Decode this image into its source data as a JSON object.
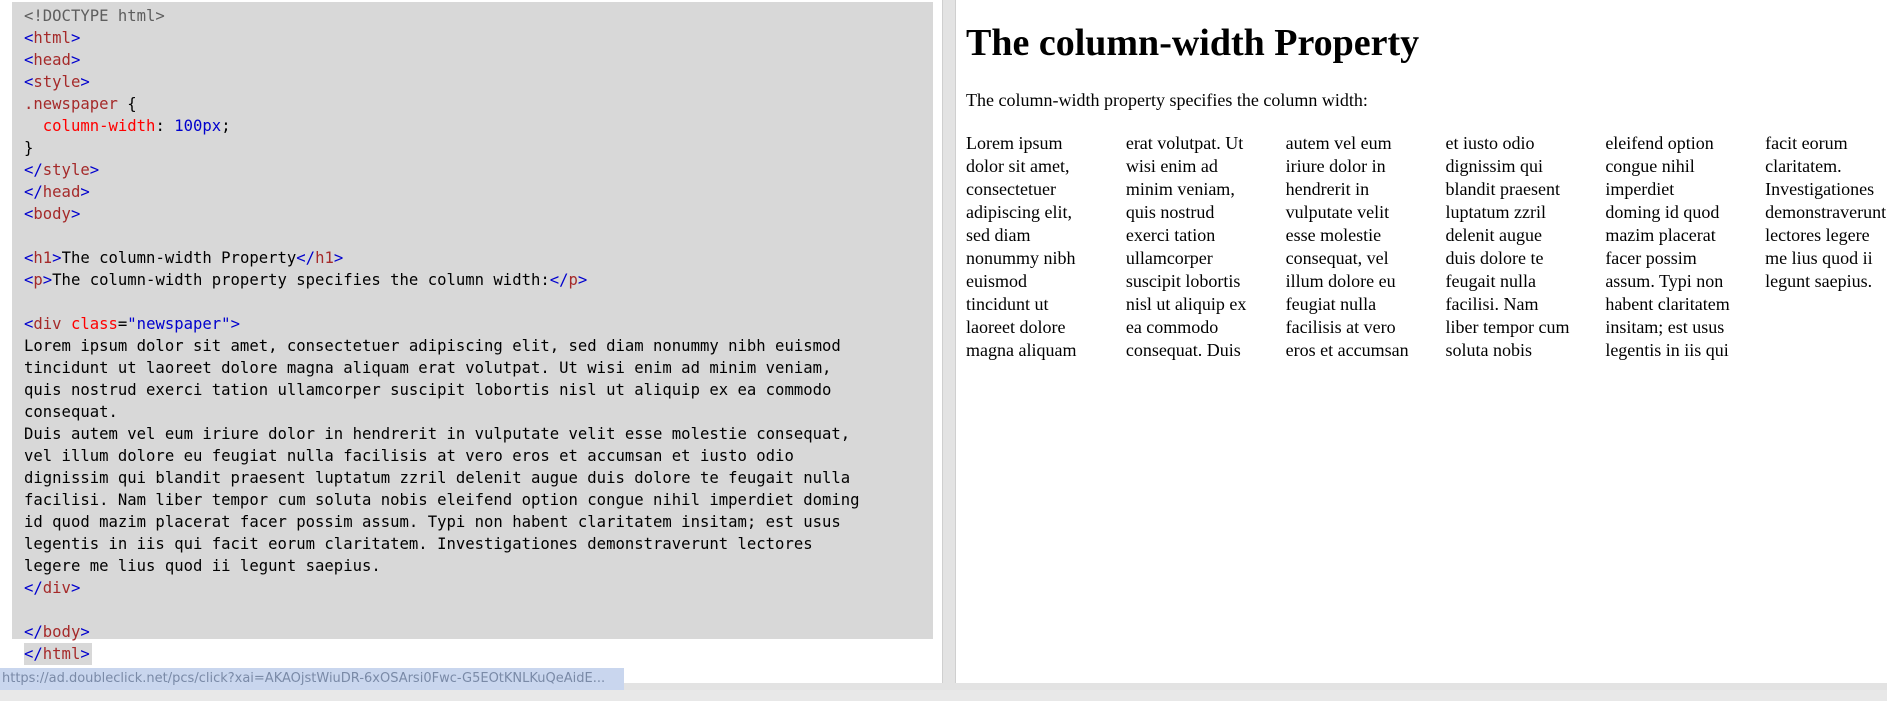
{
  "editor": {
    "lines": [
      [
        {
          "c": "t-doctype",
          "t": "<!DOCTYPE html>"
        }
      ],
      [
        {
          "c": "t-br",
          "t": "<"
        },
        {
          "c": "t-tag",
          "t": "html"
        },
        {
          "c": "t-br",
          "t": ">"
        }
      ],
      [
        {
          "c": "t-br",
          "t": "<"
        },
        {
          "c": "t-tag",
          "t": "head"
        },
        {
          "c": "t-br",
          "t": ">"
        }
      ],
      [
        {
          "c": "t-br",
          "t": "<"
        },
        {
          "c": "t-tag",
          "t": "style"
        },
        {
          "c": "t-br",
          "t": ">"
        }
      ],
      [
        {
          "c": "t-sel",
          "t": ".newspaper"
        },
        {
          "c": "t-text",
          "t": " {"
        }
      ],
      [
        {
          "c": "t-text",
          "t": "  "
        },
        {
          "c": "t-prop",
          "t": "column-width"
        },
        {
          "c": "t-text",
          "t": ": "
        },
        {
          "c": "t-val",
          "t": "100px"
        },
        {
          "c": "t-text",
          "t": ";"
        }
      ],
      [
        {
          "c": "t-text",
          "t": "}"
        }
      ],
      [
        {
          "c": "t-br",
          "t": "</"
        },
        {
          "c": "t-tag",
          "t": "style"
        },
        {
          "c": "t-br",
          "t": ">"
        }
      ],
      [
        {
          "c": "t-br",
          "t": "</"
        },
        {
          "c": "t-tag",
          "t": "head"
        },
        {
          "c": "t-br",
          "t": ">"
        }
      ],
      [
        {
          "c": "t-br",
          "t": "<"
        },
        {
          "c": "t-tag",
          "t": "body"
        },
        {
          "c": "t-br",
          "t": ">"
        }
      ],
      [],
      [
        {
          "c": "t-br",
          "t": "<"
        },
        {
          "c": "t-tag",
          "t": "h1"
        },
        {
          "c": "t-br",
          "t": ">"
        },
        {
          "c": "t-text",
          "t": "The column-width Property"
        },
        {
          "c": "t-br",
          "t": "</"
        },
        {
          "c": "t-tag",
          "t": "h1"
        },
        {
          "c": "t-br",
          "t": ">"
        }
      ],
      [
        {
          "c": "t-br",
          "t": "<"
        },
        {
          "c": "t-tag",
          "t": "p"
        },
        {
          "c": "t-br",
          "t": ">"
        },
        {
          "c": "t-text",
          "t": "The column-width property specifies the column width:"
        },
        {
          "c": "t-br",
          "t": "</"
        },
        {
          "c": "t-tag",
          "t": "p"
        },
        {
          "c": "t-br",
          "t": ">"
        }
      ],
      [],
      [
        {
          "c": "t-br",
          "t": "<"
        },
        {
          "c": "t-tag",
          "t": "div"
        },
        {
          "c": "t-text",
          "t": " "
        },
        {
          "c": "t-attr",
          "t": "class"
        },
        {
          "c": "t-text",
          "t": "="
        },
        {
          "c": "t-attrv",
          "t": "\"newspaper\""
        },
        {
          "c": "t-br",
          "t": ">"
        }
      ],
      [
        {
          "c": "t-text",
          "t": "Lorem ipsum dolor sit amet, consectetuer adipiscing elit, sed diam nonummy nibh euismod"
        }
      ],
      [
        {
          "c": "t-text",
          "t": "tincidunt ut laoreet dolore magna aliquam erat volutpat. Ut wisi enim ad minim veniam,"
        }
      ],
      [
        {
          "c": "t-text",
          "t": "quis nostrud exerci tation ullamcorper suscipit lobortis nisl ut aliquip ex ea commodo"
        }
      ],
      [
        {
          "c": "t-text",
          "t": "consequat."
        }
      ],
      [
        {
          "c": "t-text",
          "t": "Duis autem vel eum iriure dolor in hendrerit in vulputate velit esse molestie consequat,"
        }
      ],
      [
        {
          "c": "t-text",
          "t": "vel illum dolore eu feugiat nulla facilisis at vero eros et accumsan et iusto odio"
        }
      ],
      [
        {
          "c": "t-text",
          "t": "dignissim qui blandit praesent luptatum zzril delenit augue duis dolore te feugait nulla"
        }
      ],
      [
        {
          "c": "t-text",
          "t": "facilisi. Nam liber tempor cum soluta nobis eleifend option congue nihil imperdiet doming"
        }
      ],
      [
        {
          "c": "t-text",
          "t": "id quod mazim placerat facer possim assum. Typi non habent claritatem insitam; est usus"
        }
      ],
      [
        {
          "c": "t-text",
          "t": "legentis in iis qui facit eorum claritatem. Investigationes demonstraverunt lectores"
        }
      ],
      [
        {
          "c": "t-text",
          "t": "legere me lius quod ii legunt saepius."
        }
      ],
      [
        {
          "c": "t-br",
          "t": "</"
        },
        {
          "c": "t-tag",
          "t": "div"
        },
        {
          "c": "t-br",
          "t": ">"
        }
      ],
      [],
      [
        {
          "c": "t-br",
          "t": "</"
        },
        {
          "c": "t-tag",
          "t": "body"
        },
        {
          "c": "t-br",
          "t": ">"
        }
      ],
      [
        {
          "c": "t-br",
          "t": "</"
        },
        {
          "c": "t-tag",
          "t": "html"
        },
        {
          "c": "t-br",
          "t": ">"
        }
      ]
    ],
    "colors": {
      "selection_bg": "#d8d8d8",
      "tag": "#a52a2a",
      "bracket": "#0000cd",
      "property": "#ff0000",
      "value": "#0000cd"
    }
  },
  "status_bar": {
    "url": "https://ad.doubleclick.net/pcs/click?xai=AKAOjstWiuDR-6xOSArsi0Fwc-G5EOtKNLKuQeAidE..."
  },
  "result": {
    "heading": "The column-width Property",
    "intro": "The column-width property specifies the column width:",
    "newspaper_text": "Lorem ipsum dolor sit amet, consectetuer adipiscing elit, sed diam nonummy nibh euismod tincidunt ut laoreet dolore magna aliquam erat volutpat. Ut wisi enim ad minim veniam, quis nostrud exerci tation ullamcorper suscipit lobortis nisl ut aliquip ex ea commodo consequat. Duis autem vel eum iriure dolor in hendrerit in vulputate velit esse molestie consequat, vel illum dolore eu feugiat nulla facilisis at vero eros et accumsan et iusto odio dignissim qui blandit praesent luptatum zzril delenit augue duis dolore te feugait nulla facilisi. Nam liber tempor cum soluta nobis eleifend option congue nihil imperdiet doming id quod mazim placerat facer possim assum. Typi non habent claritatem insitam; est usus legentis in iis qui facit eorum claritatem. Investigationes demonstraverunt lectores legere me lius quod ii legunt saepius."
  }
}
